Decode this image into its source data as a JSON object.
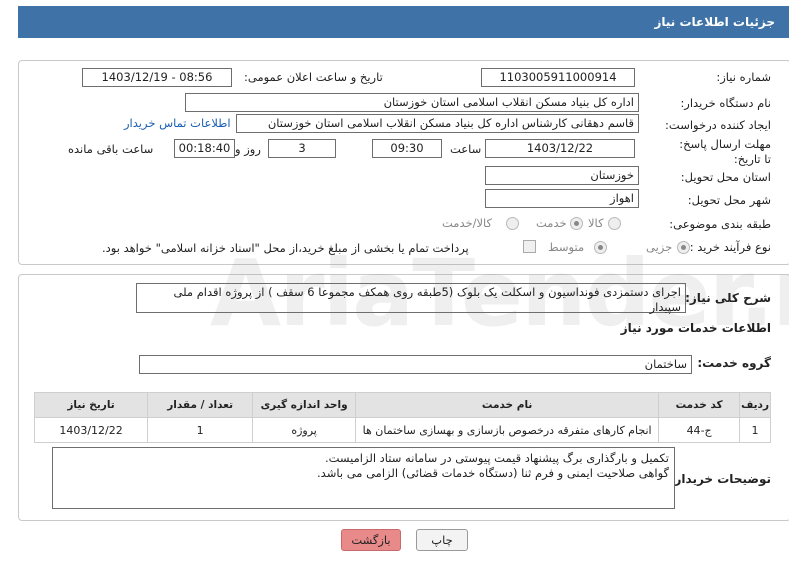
{
  "header": {
    "title": "جزئیات اطلاعات نیاز"
  },
  "fields": {
    "need_number_label": "شماره نیاز:",
    "need_number": "1103005911000914",
    "announce_label": "تاریخ و ساعت اعلان عمومی:",
    "announce_value": "1403/12/19 - 08:56",
    "buyer_label": "نام دستگاه خریدار:",
    "buyer_value": "اداره کل بنیاد مسکن انقلاب اسلامی استان خوزستان",
    "creator_label": "ایجاد کننده درخواست:",
    "creator_value": "قاسم دهقانی کارشناس اداره کل بنیاد مسکن انقلاب اسلامی استان خوزستان",
    "contact_link": "اطلاعات تماس خریدار",
    "deadline_label": "مهلت ارسال پاسخ: تا تاریخ:",
    "deadline_date": "1403/12/22",
    "time_label": "ساعت",
    "deadline_time": "09:30",
    "days_value": "3",
    "days_label": "روز و",
    "remaining_value": "00:18:40",
    "remaining_label": "ساعت باقی مانده",
    "province_label": "استان محل تحویل:",
    "province_value": "خوزستان",
    "city_label": "شهر محل تحویل:",
    "city_value": "اهواز",
    "category_label": "طبقه بندی موضوعی:",
    "category_options": [
      "کالا",
      "خدمت",
      "کالا/خدمت"
    ],
    "category_selected": "خدمت",
    "process_label": "نوع فرآیند خرید :",
    "process_options": [
      "جزیی",
      "متوسط"
    ],
    "process_selected": "جزیی",
    "payment_note": "پرداخت تمام یا بخشی از مبلغ خرید،از محل \"اسناد خزانه اسلامی\" خواهد بود."
  },
  "summary": {
    "label": "شرح کلی نیاز:",
    "text": "اجرای دستمزدی فونداسیون و اسکلت یک بلوک (5طبقه روی همکف مجموعا 6 سقف ) از پروژه اقدام ملی سپیدار"
  },
  "services": {
    "section_title": "اطلاعات خدمات مورد نیاز",
    "group_label": "گروه خدمت:",
    "group_value": "ساختمان",
    "columns": [
      "ردیف",
      "کد خدمت",
      "نام خدمت",
      "واحد اندازه گیری",
      "تعداد / مقدار",
      "تاریخ نیاز"
    ],
    "rows": [
      [
        "1",
        "ج-44",
        "انجام کارهای متفرقه درخصوص بازسازی و بهسازی ساختمان ها",
        "پروژه",
        "1",
        "1403/12/22"
      ]
    ]
  },
  "notes": {
    "label": "توضیحات خریدار:",
    "line1": "تکمیل و بارگذاری برگ پیشنهاد قیمت پیوستی در سامانه ستاد الزامیست.",
    "line2": "گواهی صلاحیت ایمنی و فرم ثنا (دستگاه خدمات قضائی) الزامی می باشد."
  },
  "buttons": {
    "print": "چاپ",
    "back": "بازگشت"
  },
  "watermark": "AriaTender.neT",
  "colors": {
    "header_bg": "#3f73a8",
    "back_button_bg": "#e98a8a"
  }
}
